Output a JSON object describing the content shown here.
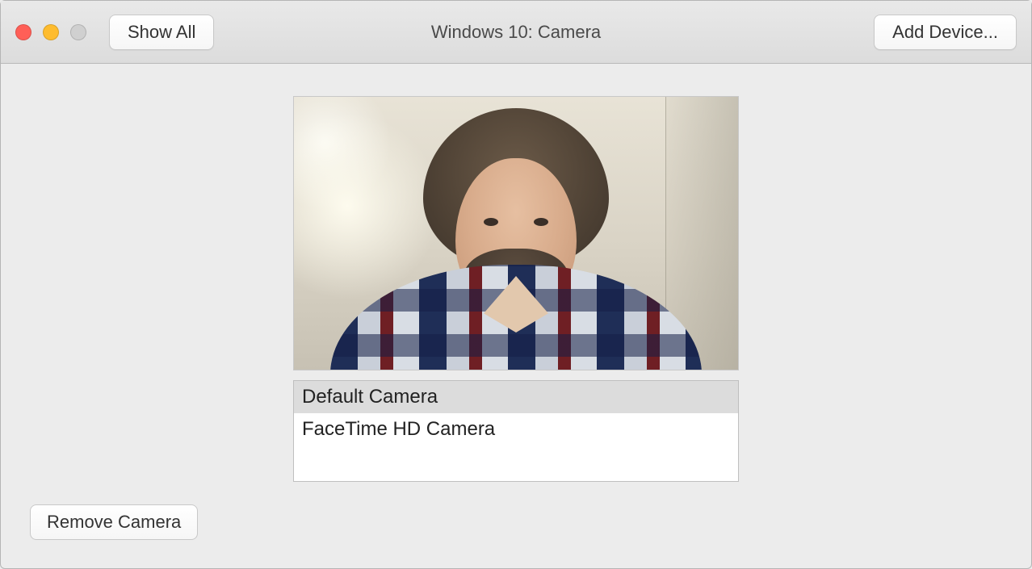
{
  "window": {
    "title": "Windows 10: Camera"
  },
  "toolbar": {
    "show_all_label": "Show All",
    "add_device_label": "Add Device..."
  },
  "camera": {
    "items": [
      {
        "label": "Default Camera",
        "selected": true
      },
      {
        "label": "FaceTime HD Camera",
        "selected": false
      }
    ]
  },
  "actions": {
    "remove_camera_label": "Remove Camera"
  }
}
